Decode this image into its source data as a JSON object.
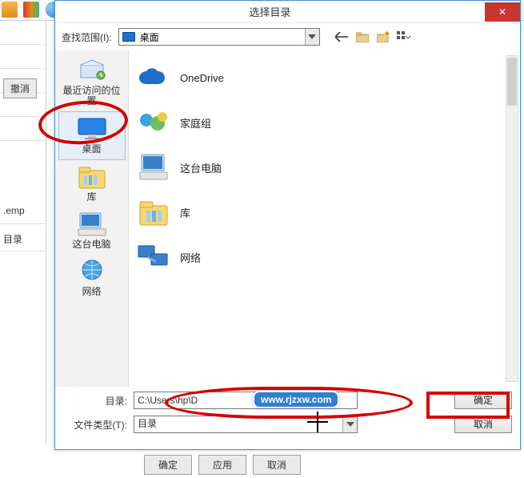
{
  "dialog": {
    "title": "选择目录",
    "close_glyph": "✕",
    "lookin_label": "查找范围(I):",
    "lookin_value": "桌面",
    "toolbar": {
      "back_icon": "back-arrow",
      "folder_icon": "folder-small",
      "newfolder_icon": "new-folder",
      "view_icon": "view-grid"
    }
  },
  "places": [
    {
      "id": "recent",
      "label": "最近访问的位置",
      "icon": "recent-icon",
      "selected": false
    },
    {
      "id": "desktop",
      "label": "桌面",
      "icon": "desktop-icon",
      "selected": true
    },
    {
      "id": "library",
      "label": "库",
      "icon": "library-icon",
      "selected": false
    },
    {
      "id": "thispc",
      "label": "这台电脑",
      "icon": "computer-icon",
      "selected": false
    },
    {
      "id": "network",
      "label": "网络",
      "icon": "network-icon",
      "selected": false
    }
  ],
  "folders": [
    {
      "id": "onedrive",
      "label": "OneDrive",
      "icon": "cloud-icon"
    },
    {
      "id": "homegroup",
      "label": "家庭组",
      "icon": "homegroup-icon"
    },
    {
      "id": "thispc2",
      "label": "这台电脑",
      "icon": "computer-icon"
    },
    {
      "id": "library2",
      "label": "库",
      "icon": "library-icon"
    },
    {
      "id": "network2",
      "label": "网络",
      "icon": "network-monitor-icon"
    }
  ],
  "footer": {
    "dir_label": "目录:",
    "dir_value": "C:\\Users\\hp\\D",
    "type_label": "文件类型(T):",
    "type_value": "目录",
    "ok_label": "确定",
    "cancel_label": "取消"
  },
  "background": {
    "cancel_btn": "撤消",
    "temp_label": ".emp",
    "dir_label": "目录",
    "bottom_ok": "确定",
    "bottom_apply": "应用",
    "bottom_cancel": "取消"
  },
  "watermark": "www.rjzxw.com"
}
